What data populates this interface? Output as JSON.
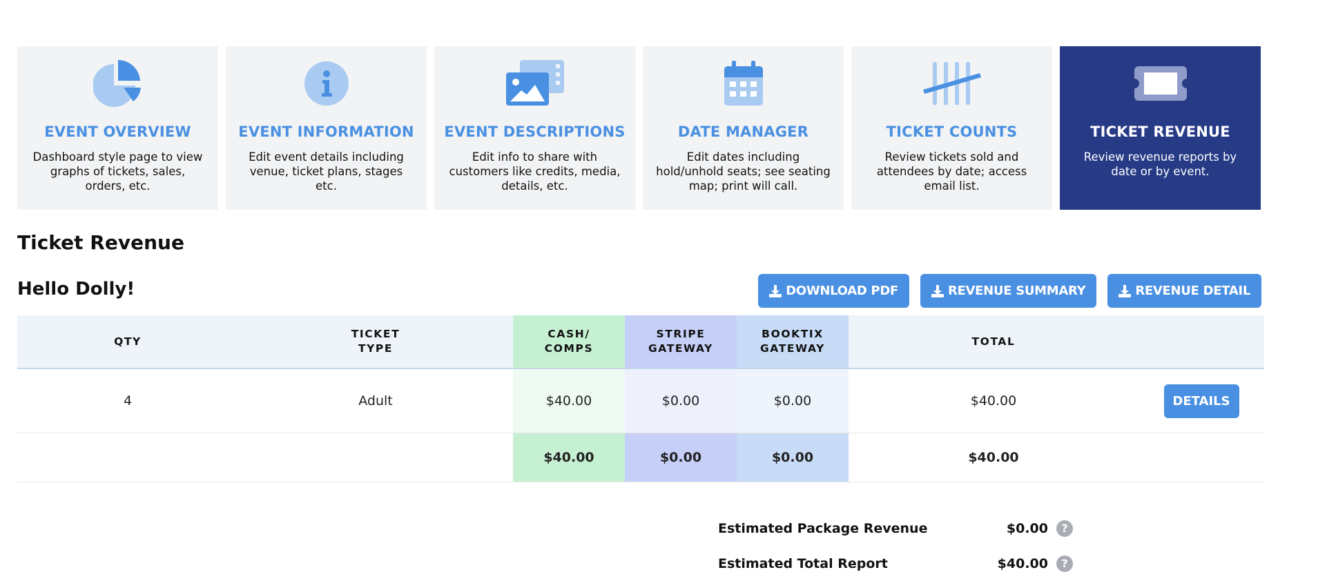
{
  "cards": [
    {
      "icon": "pie-chart-icon",
      "title": "EVENT OVERVIEW",
      "desc": "Dashboard style page to view graphs of tickets, sales, orders, etc."
    },
    {
      "icon": "info-icon",
      "title": "EVENT INFORMATION",
      "desc": "Edit event details including venue, ticket plans, stages etc."
    },
    {
      "icon": "images-icon",
      "title": "EVENT DESCRIPTIONS",
      "desc": "Edit info to share with customers like credits, media, details, etc."
    },
    {
      "icon": "calendar-icon",
      "title": "DATE MANAGER",
      "desc": "Edit dates including hold/unhold seats; see seating map; print will call."
    },
    {
      "icon": "tally-icon",
      "title": "TICKET COUNTS",
      "desc": "Review tickets sold and attendees by date; access email list."
    },
    {
      "icon": "ticket-icon",
      "title": "TICKET REVENUE",
      "desc": "Review revenue reports by date or by event."
    }
  ],
  "page_title": "Ticket Revenue",
  "event_name": "Hello Dolly!",
  "actions": {
    "download_pdf": "DOWNLOAD PDF",
    "revenue_summary": "REVENUE SUMMARY",
    "revenue_detail": "REVENUE DETAIL"
  },
  "table": {
    "headers": {
      "qty": "QTY",
      "type_l1": "TICKET",
      "type_l2": "TYPE",
      "cash_l1": "CASH/",
      "cash_l2": "COMPS",
      "stripe_l1": "STRIPE",
      "stripe_l2": "GATEWAY",
      "booktix_l1": "BOOKTIX",
      "booktix_l2": "GATEWAY",
      "total": "TOTAL"
    },
    "row": {
      "qty": "4",
      "type": "Adult",
      "cash": "$40.00",
      "stripe": "$0.00",
      "booktix": "$0.00",
      "total": "$40.00",
      "details": "DETAILS"
    },
    "totals": {
      "cash": "$40.00",
      "stripe": "$0.00",
      "booktix": "$0.00",
      "total": "$40.00"
    }
  },
  "summary": {
    "package_label": "Estimated Package Revenue",
    "package_value": "$0.00",
    "total_label": "Estimated Total Report",
    "total_value": "$40.00",
    "help_glyph": "?"
  },
  "colors": {
    "accent": "#4a90e2",
    "active_card": "#263a86",
    "card_bg": "#f1f3f5"
  }
}
